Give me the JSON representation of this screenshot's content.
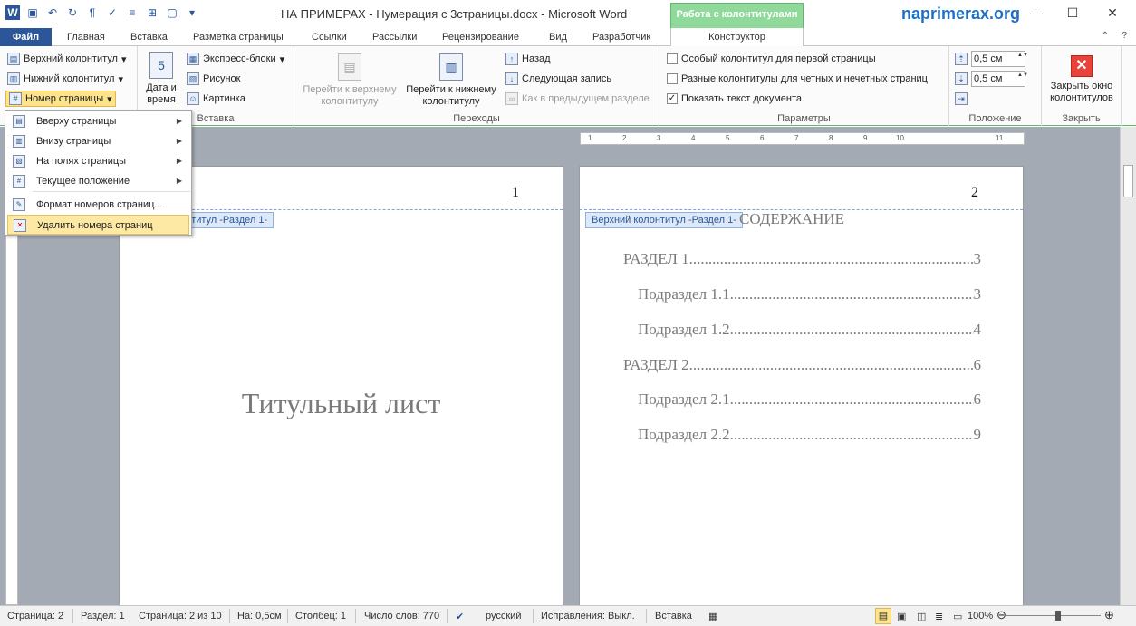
{
  "window": {
    "title": "НА ПРИМЕРАХ - Нумерация с 3страницы.docx - Microsoft Word",
    "context_tab": "Работа с колонтитулами",
    "brand": "naprimerax.org"
  },
  "tabs": [
    "Файл",
    "Главная",
    "Вставка",
    "Разметка страницы",
    "Ссылки",
    "Рассылки",
    "Рецензирование",
    "Вид",
    "Разработчик",
    "Конструктор"
  ],
  "ribbon": {
    "group1": {
      "header": "Верхний колонтитул",
      "footer": "Нижний колонтитул",
      "page_number": "Номер страницы"
    },
    "insert": {
      "date_time_1": "Дата и",
      "date_time_2": "время",
      "express_blocks": "Экспресс-блоки",
      "picture": "Рисунок",
      "clipart": "Картинка",
      "label": "Вставка"
    },
    "nav": {
      "goto_header_1": "Перейти к верхнему",
      "goto_header_2": "колонтитулу",
      "goto_footer_1": "Перейти к нижнему",
      "goto_footer_2": "колонтитулу",
      "back": "Назад",
      "next": "Следующая запись",
      "link_prev": "Как в предыдущем разделе",
      "label": "Переходы"
    },
    "params": {
      "first_page": "Особый колонтитул для первой страницы",
      "odd_even": "Разные колонтитулы для четных и нечетных страниц",
      "show_text": "Показать текст документа",
      "label": "Параметры"
    },
    "position": {
      "top_value": "0,5 см",
      "bottom_value": "0,5 см",
      "label": "Положение"
    },
    "close": {
      "btn_1": "Закрыть окно",
      "btn_2": "колонтитулов",
      "label": "Закрыть"
    }
  },
  "menu": {
    "items": [
      "Вверху страницы",
      "Внизу страницы",
      "На полях страницы",
      "Текущее положение",
      "Формат номеров страниц...",
      "Удалить номера страниц"
    ]
  },
  "ruler_ticks": [
    "1",
    "2",
    "3",
    "4",
    "5",
    "6",
    "7",
    "8",
    "9",
    "10",
    "11"
  ],
  "pages": {
    "left": {
      "number": "1",
      "header_tag": "онтитул -Раздел 1-",
      "title": "Титульный лист"
    },
    "right": {
      "number": "2",
      "header_tag": "Верхний колонтитул -Раздел 1-",
      "toc_heading": "СОДЕРЖАНИЕ",
      "toc": [
        {
          "text": "РАЗДЕЛ 1",
          "page": "3",
          "level": 1
        },
        {
          "text": "Подраздел 1.1",
          "page": "3",
          "level": 2
        },
        {
          "text": "Подраздел 1.2",
          "page": "4",
          "level": 2
        },
        {
          "text": "РАЗДЕЛ 2",
          "page": "6",
          "level": 1
        },
        {
          "text": "Подраздел 2.1",
          "page": "6",
          "level": 2
        },
        {
          "text": "Подраздел 2.2",
          "page": "9",
          "level": 2
        }
      ]
    }
  },
  "status": {
    "page": "Страница: 2",
    "section": "Раздел: 1",
    "page_of": "Страница: 2 из 10",
    "at": "На: 0,5см",
    "column": "Столбец: 1",
    "words": "Число слов: 770",
    "language": "русский",
    "track": "Исправления: Выкл.",
    "insert": "Вставка",
    "zoom": "100%"
  },
  "colors": {
    "accent": "#2b579a",
    "context_green": "#8fd99a",
    "brand": "#1e6fc8",
    "highlight": "#fde38a"
  }
}
